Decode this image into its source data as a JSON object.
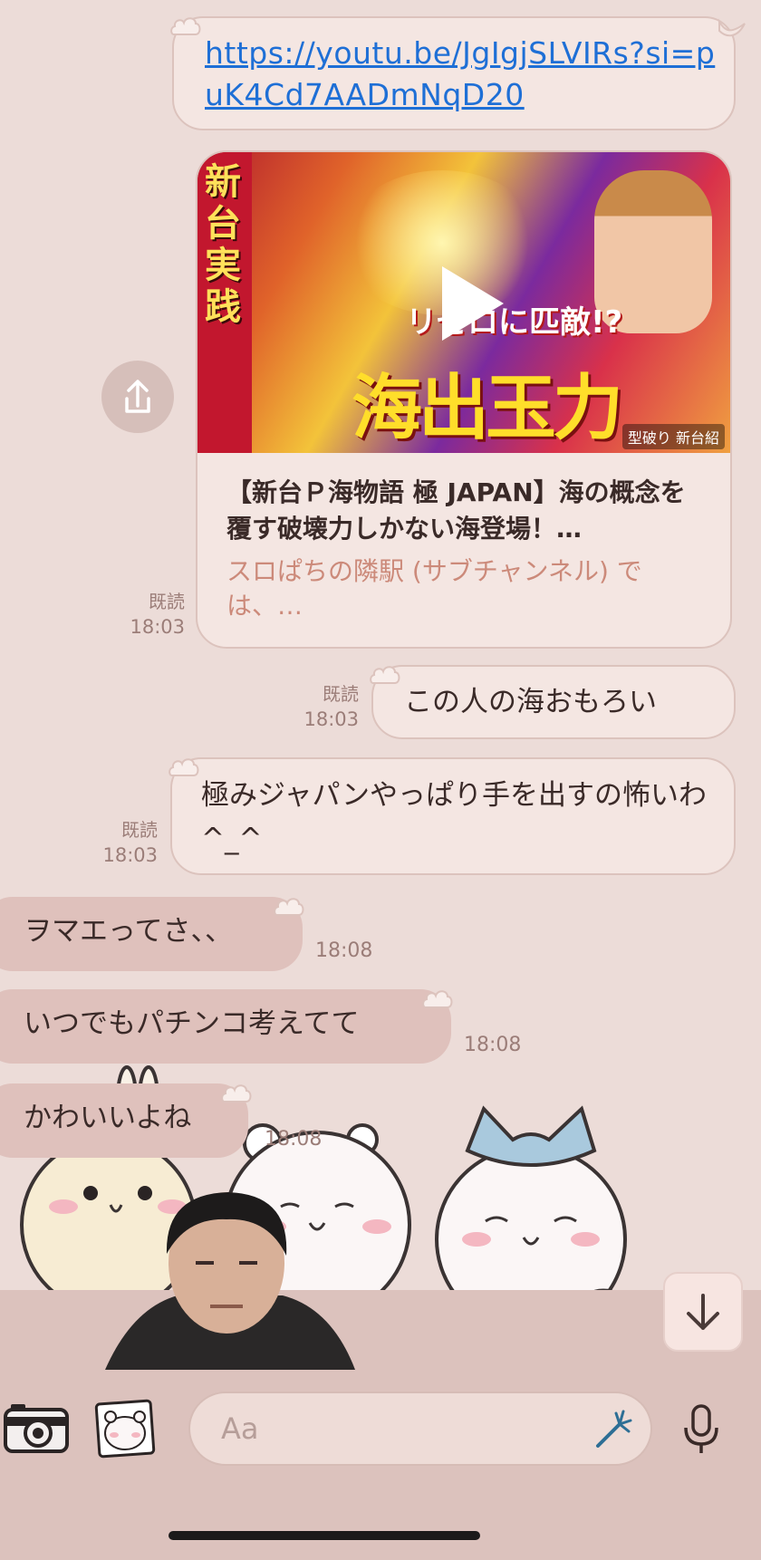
{
  "messages": {
    "link_msg": {
      "url": "https://youtu.be/JgIgjSLVIRs?si=puK4Cd7AADmNqD20"
    },
    "preview": {
      "title": "【新台Ｐ海物語 極 JAPAN】海の概念を覆す破壊力しかない海登場！…",
      "channel": "スロぱちの隣駅 (サブチャンネル) では、…",
      "read": "既読",
      "time": "18:03"
    },
    "out1": {
      "text": "この人の海おもろい",
      "read": "既読",
      "time": "18:03"
    },
    "out2": {
      "text": "極みジャパンやっぱり手を出すの怖いわ^_^",
      "read": "既読",
      "time": "18:03"
    },
    "in1": {
      "text": "ヲマエってさ、、",
      "time": "18:08"
    },
    "in2": {
      "text": "いつでもパチンコ考えてて",
      "time": "18:08"
    },
    "in3": {
      "text": "かわいいよね",
      "time": "18:08"
    }
  },
  "thumbnail": {
    "vertical_text": "新台実践",
    "sub_text": "リゼロに匹敵!?",
    "big_text": "海出玉力",
    "tag": "型破り 新台紹"
  },
  "input": {
    "placeholder": "Aa"
  },
  "icons": {
    "camera": "camera-icon",
    "sticker": "sticker-icon",
    "emoji_wand": "wand-icon",
    "mic": "microphone-icon",
    "share": "share-icon",
    "scroll_down": "arrow-down-icon",
    "play": "play-icon"
  },
  "colors": {
    "background": "#ecdcd8",
    "outgoing_bubble": "#f4e6e2",
    "incoming_bubble": "#dfc1bc",
    "link": "#1e6fd6"
  }
}
